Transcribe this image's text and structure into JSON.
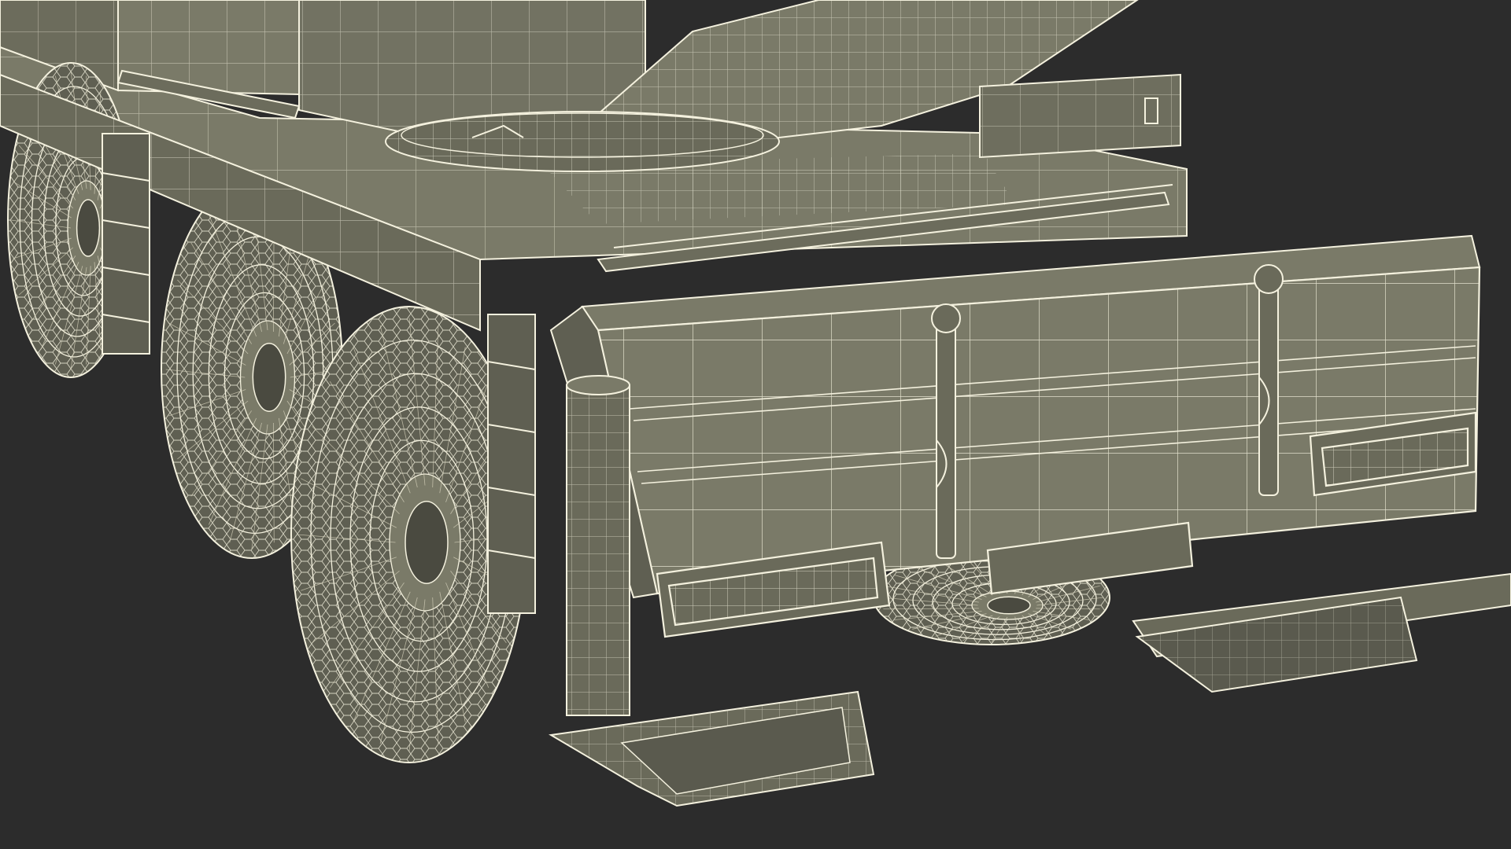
{
  "scene": {
    "subject": "crane-truck-rear-wireframe",
    "colors": {
      "background": "#2c2c2c",
      "body_fill": "#7a7a68",
      "body_dark": "#5f5f52",
      "shadow": "#4a4a40",
      "wire": "#f4f1de",
      "wire_dim": "#d8d4bd"
    }
  }
}
